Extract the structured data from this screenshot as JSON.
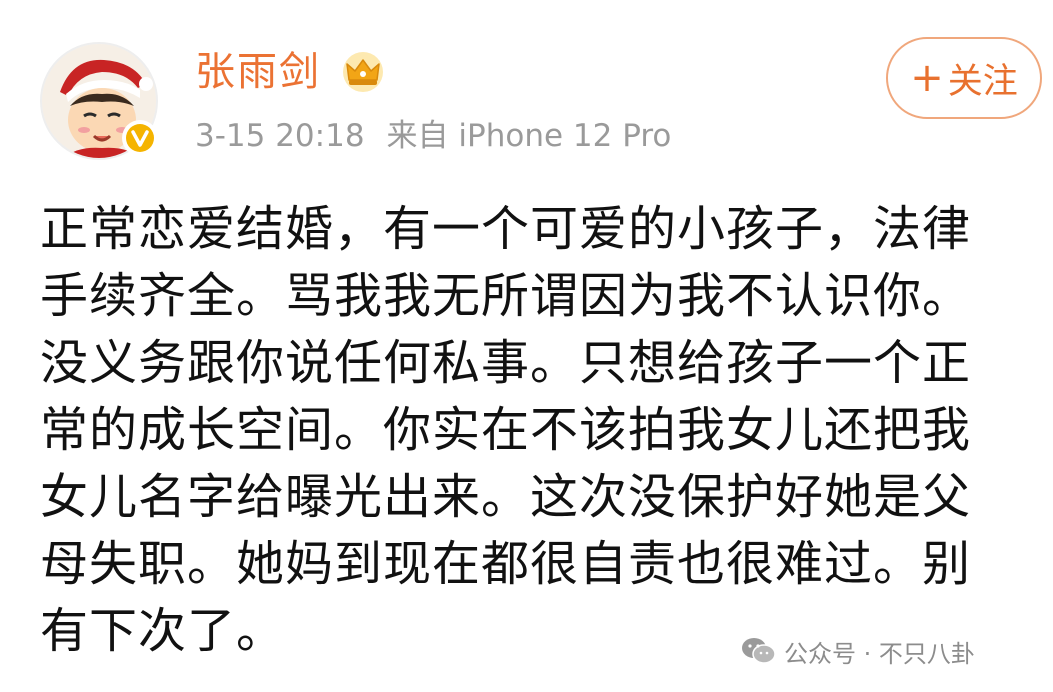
{
  "user": {
    "name": "张雨剑",
    "timestamp": "3-15 20:18",
    "source": "来自 iPhone 12 Pro",
    "badge_icon": "crown-icon",
    "verified_icon": "verified-v-icon"
  },
  "follow_button": {
    "plus": "+",
    "label": "关注"
  },
  "post": {
    "lines": [
      "正常恋爱结婚，有一个可爱的小孩子，法律",
      "手续齐全。骂我我无所谓因为我不认识你。",
      "没义务跟你说任何私事。只想给孩子一个正",
      "常的成长空间。你实在不该拍我女儿还把我",
      "女儿名字给曝光出来。这次没保护好她是父",
      "母失职。她妈到现在都很自责也很难过。别",
      "有下次了。"
    ]
  },
  "watermark": {
    "text": "公众号 · 不只八卦",
    "icon": "wechat-icon"
  },
  "colors": {
    "username": "#eb7233",
    "follow": "#e8712f",
    "follow_border": "#f0a77c",
    "meta": "#9a9a9a",
    "text": "#111111",
    "verified": "#f5b400"
  }
}
